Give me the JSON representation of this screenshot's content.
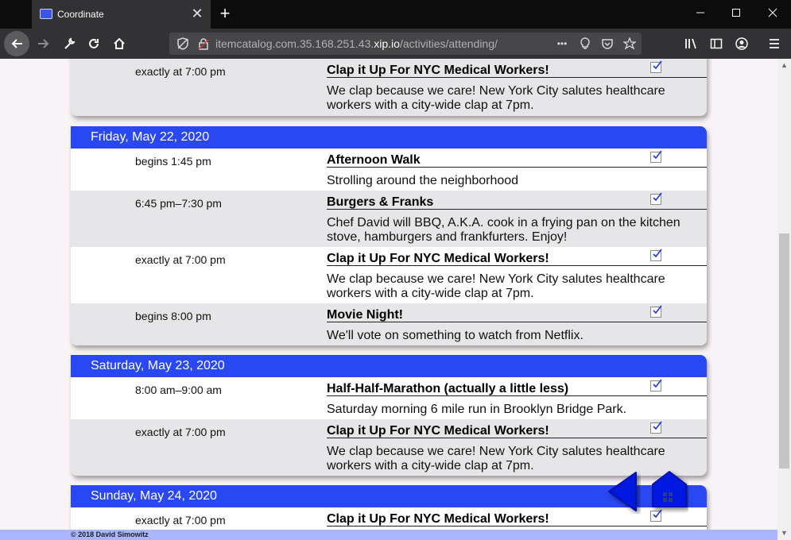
{
  "browser": {
    "tab_title": "Coordinate",
    "tab_close": "✕",
    "new_tab": "+",
    "url_dim": "itemcatalog.com.35.168.251.43.",
    "url_host": "xip.io",
    "url_path": "/activities/attending/",
    "url_more": "•••"
  },
  "top_partial": {
    "time": "exactly at 7:00 pm",
    "title": "Clap it Up For NYC Medical Workers!",
    "description": "We clap because we care! New York City salutes healthcare workers with a city-wide clap at 7pm."
  },
  "days": [
    {
      "header": "Friday, May 22, 2020",
      "events": [
        {
          "time": "begins 1:45 pm",
          "title": "Afternoon Walk",
          "description": "Strolling around the neighborhood"
        },
        {
          "time": "6:45 pm–7:30 pm",
          "title": "Burgers & Franks",
          "description": "Chef David will BBQ, A.K.A. cook in a frying pan on the kitchen stove, hamburgers and frankfurters. Enjoy!"
        },
        {
          "time": "exactly at 7:00 pm",
          "title": "Clap it Up For NYC Medical Workers!",
          "description": "We clap because we care! New York City salutes healthcare workers with a city-wide clap at 7pm."
        },
        {
          "time": "begins 8:00 pm",
          "title": "Movie Night!",
          "description": "We'll vote on something to watch from Netflix."
        }
      ]
    },
    {
      "header": "Saturday, May 23, 2020",
      "events": [
        {
          "time": "8:00 am–9:00 am",
          "title": "Half-Half-Marathon (actually a little less)",
          "description": "Saturday morning 6 mile run in Brooklyn Bridge Park."
        },
        {
          "time": "exactly at 7:00 pm",
          "title": "Clap it Up For NYC Medical Workers!",
          "description": "We clap because we care! New York City salutes healthcare workers with a city-wide clap at 7pm."
        }
      ]
    },
    {
      "header": "Sunday, May 24, 2020",
      "events": [
        {
          "time": "exactly at 7:00 pm",
          "title": "Clap it Up For NYC Medical Workers!",
          "description": ""
        }
      ]
    }
  ],
  "footer": "© 2018 David Simowitz",
  "colors": {
    "accent": "#2a48f2",
    "row_gray": "#e6e6e8",
    "fab_blue": "#0018e0",
    "footer": "#a9b6ff"
  }
}
